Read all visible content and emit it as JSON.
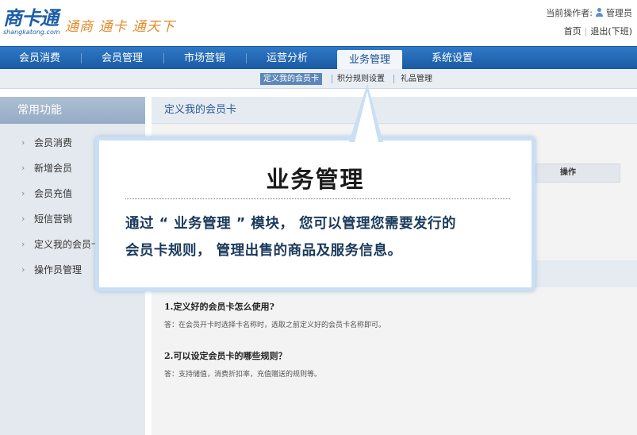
{
  "brand": {
    "logo_text": "商卡通",
    "logo_domain": "shangkatong.com",
    "slogan": "通商 通卡 通天下"
  },
  "top_bar": {
    "operator_label": "当前操作者:",
    "operator_name": "管理员",
    "home_link": "首页",
    "logout_link": "退出(下班)"
  },
  "main_nav": {
    "items": [
      {
        "label": "会员消费"
      },
      {
        "label": "会员管理"
      },
      {
        "label": "市场营销"
      },
      {
        "label": "运营分析"
      },
      {
        "label": "业务管理"
      },
      {
        "label": "系统设置"
      }
    ],
    "active": "业务管理"
  },
  "sub_nav": {
    "items": [
      {
        "label": "定义我的会员卡"
      },
      {
        "label": "积分规则设置"
      },
      {
        "label": "礼品管理"
      }
    ],
    "active": "定义我的会员卡"
  },
  "sidebar": {
    "title": "常用功能",
    "items": [
      {
        "label": "会员消费"
      },
      {
        "label": "新增会员"
      },
      {
        "label": "会员充值"
      },
      {
        "label": "短信营销"
      },
      {
        "label": "定义我的会员卡"
      },
      {
        "label": "操作员管理"
      }
    ]
  },
  "content": {
    "panel_title": "定义我的会员卡",
    "table_header_action": "操作",
    "faq": [
      {
        "q": "1.定义好的会员卡怎么使用?",
        "a": "答：在会员开卡时选择卡名称时，选取之前定义好的会员卡名称即可。"
      },
      {
        "q": "2.可以设定会员卡的哪些规则？",
        "a": "答：支持储值，消费折扣率，充值赠送的规则等。"
      }
    ]
  },
  "callout": {
    "title": "业务管理",
    "line1": "通过 “ 业务管理 ” 模块， 您可以管理您需要发行的",
    "line2": "会员卡规则， 管理出售的商品及服务信息。"
  },
  "colors": {
    "nav_blue": "#1a5aa3",
    "slogan_orange": "#e38b2a",
    "callout_border": "#c9dff5"
  }
}
